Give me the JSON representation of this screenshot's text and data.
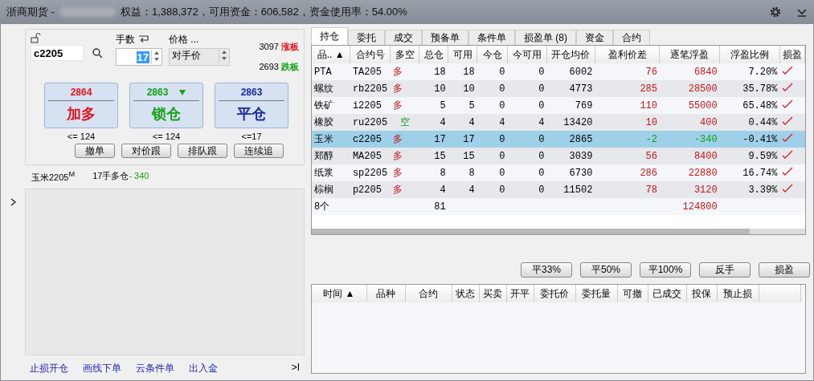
{
  "title_bar": {
    "broker": "浙商期货 -",
    "summary": "权益：1,388,372，可用资金：606,582，资金使用率：54.00%"
  },
  "order": {
    "contract": "c2205",
    "qty_label": "手数",
    "qty": "17",
    "price_label": "价格 ...",
    "price_mode": "对手价",
    "limit_up": "3097",
    "limit_up_label": "涨板",
    "limit_down": "2693",
    "limit_down_label": "跌板",
    "actions": [
      {
        "price": "2864",
        "label": "加多",
        "limit": "<= 124",
        "kind": "buy",
        "arrow": false
      },
      {
        "price": "2863",
        "label": "锁仓",
        "limit": "<= 124",
        "kind": "lock",
        "arrow": true
      },
      {
        "price": "2863",
        "label": "平仓",
        "limit": "<=17",
        "kind": "close",
        "arrow": false
      }
    ],
    "buttons": [
      "撤单",
      "对价跟",
      "排队跟",
      "连续追"
    ]
  },
  "position_line": {
    "contract": "玉米2205$^{M}$",
    "text": "17手多仓",
    "pnl": "- 340"
  },
  "bottom_links": [
    "止损开仓",
    "画线下单",
    "云条件单",
    "出入金"
  ],
  "collapse_button": ">I",
  "tabs": [
    {
      "label": "持仓",
      "selected": true
    },
    {
      "label": "委托",
      "selected": false
    },
    {
      "label": "成交",
      "selected": false
    },
    {
      "label": "预备单",
      "selected": false
    },
    {
      "label": "条件单",
      "selected": false
    },
    {
      "label": "损盈单 (8)",
      "selected": false
    },
    {
      "label": "资金",
      "selected": false
    },
    {
      "label": "合约",
      "selected": false
    }
  ],
  "positions": {
    "columns": [
      "品.. ▲",
      "合约号",
      "多空",
      "总仓",
      "可用",
      "今仓",
      "今可用",
      "开仓均价",
      "盈利价差",
      "逐笔浮盈",
      "浮盈比例",
      "损盈"
    ],
    "rows": [
      {
        "cells": [
          "PTA",
          "TA205",
          "多",
          "18",
          "18",
          "0",
          "0",
          "6002",
          "76",
          "6840",
          "7.20%"
        ],
        "kind": "long",
        "profit": true,
        "selected": false
      },
      {
        "cells": [
          "螺纹",
          "rb2205",
          "多",
          "10",
          "10",
          "0",
          "0",
          "4773",
          "285",
          "28500",
          "35.78%"
        ],
        "kind": "long",
        "profit": true,
        "selected": false
      },
      {
        "cells": [
          "铁矿",
          "i2205",
          "多",
          "5",
          "5",
          "0",
          "0",
          "769",
          "110",
          "55000",
          "65.48%"
        ],
        "kind": "long",
        "profit": true,
        "selected": false
      },
      {
        "cells": [
          "橡胶",
          "ru2205",
          "空",
          "4",
          "4",
          "4",
          "4",
          "13420",
          "10",
          "400",
          "0.44%"
        ],
        "kind": "short",
        "profit": true,
        "selected": false
      },
      {
        "cells": [
          "玉米",
          "c2205",
          "多",
          "17",
          "17",
          "0",
          "0",
          "2865",
          "-2",
          "-340",
          "-0.41%"
        ],
        "kind": "long",
        "profit": false,
        "selected": true
      },
      {
        "cells": [
          "郑醇",
          "MA205",
          "多",
          "15",
          "15",
          "0",
          "0",
          "3039",
          "56",
          "8400",
          "9.59%"
        ],
        "kind": "long",
        "profit": true,
        "selected": false
      },
      {
        "cells": [
          "纸浆",
          "sp2205",
          "多",
          "8",
          "8",
          "0",
          "0",
          "6730",
          "286",
          "22880",
          "16.74%"
        ],
        "kind": "long",
        "profit": true,
        "selected": false
      },
      {
        "cells": [
          "棕榈",
          "p2205",
          "多",
          "4",
          "4",
          "0",
          "0",
          "11502",
          "78",
          "3120",
          "3.39%"
        ],
        "kind": "long",
        "profit": true,
        "selected": false
      }
    ],
    "total": {
      "count": "8个",
      "total": "81",
      "pnl": "124800"
    }
  },
  "close_buttons": [
    "平33%",
    "平50%",
    "平100%",
    "反手",
    "损盈"
  ],
  "orders": {
    "columns": [
      "时间 ▲",
      "品种",
      "合约",
      "状态",
      "买卖",
      "开平",
      "委托价",
      "委托量",
      "可撤",
      "已成交",
      "投保",
      "预止损"
    ]
  }
}
